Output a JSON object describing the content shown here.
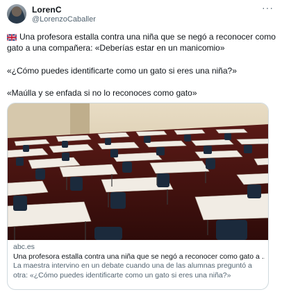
{
  "author": {
    "name": "LorenC",
    "handle": "@LorenzoCaballer"
  },
  "tweet": {
    "flag_icon": "uk-flag-icon",
    "paragraphs": [
      "Una profesora estalla contra una niña que se negó a reconocer como gato a una compañera: «Deberías estar en un manicomio»",
      "«¿Cómo puedes identificarte como un gato si eres una niña?»",
      "«Maúlla y se enfada si no lo reconoces como gato»"
    ]
  },
  "card": {
    "domain": "abc.es",
    "title": "Una profesora estalla contra una niña que se negó a reconocer como gato a ...",
    "description": "La maestra intervino en un debate cuando una de las alumnas preguntó a otra: «¿Cómo puedes identificarte como un gato si eres una niña?»",
    "image": "empty-classroom-desks-photo"
  },
  "icons": {
    "more": "more-options-icon"
  }
}
